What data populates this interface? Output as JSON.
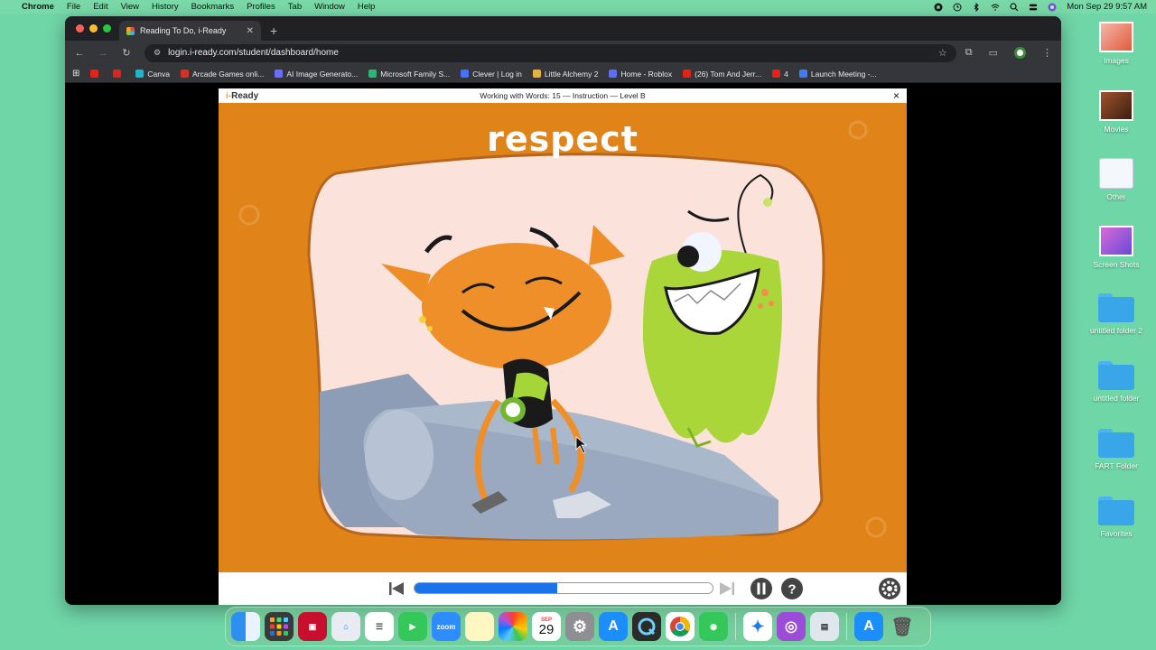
{
  "menubar": {
    "app": "Chrome",
    "items": [
      "File",
      "Edit",
      "View",
      "History",
      "Bookmarks",
      "Profiles",
      "Tab",
      "Window",
      "Help"
    ],
    "clock": "Mon Sep 29  9:57 AM"
  },
  "browser": {
    "tab_title": "Reading To Do, i-Ready",
    "url": "login.i-ready.com/student/dashboard/home",
    "bookmarks": [
      {
        "label": "",
        "color": "#e62117"
      },
      {
        "label": "",
        "color": "#e62117"
      },
      {
        "label": "Canva",
        "color": "#1fb6c9"
      },
      {
        "label": "Arcade Games onli...",
        "color": "#d93025"
      },
      {
        "label": "AI Image Generato...",
        "color": "#6c6cff"
      },
      {
        "label": "Microsoft Family S...",
        "color": "#2bb673"
      },
      {
        "label": "Clever | Log in",
        "color": "#4472ff"
      },
      {
        "label": "Little Alchemy 2",
        "color": "#e8b13a"
      },
      {
        "label": "Home - Roblox",
        "color": "#5b6ef5"
      },
      {
        "label": "(26) Tom And Jerr...",
        "color": "#e62117"
      },
      {
        "label": "4",
        "color": "#e62117"
      },
      {
        "label": "Launch Meeting -...",
        "color": "#3a7bff"
      }
    ]
  },
  "player": {
    "logo_prefix": "i-",
    "logo_text": "Ready",
    "lesson_title": "Working with Words: 15 — Instruction — Level B",
    "word": "respect",
    "progress_percent": 48,
    "icons": {
      "close": "×",
      "rewind": "⏮",
      "forward": "⏭",
      "pause": "⏸",
      "help": "?",
      "settings": "⚙"
    }
  },
  "desktop": {
    "items": [
      {
        "label": "Images"
      },
      {
        "label": "Movies"
      },
      {
        "label": "Other"
      },
      {
        "label": "Screen Shots"
      },
      {
        "label": "untitled folder 2"
      },
      {
        "label": "untitled folder"
      },
      {
        "label": "FART Folder"
      },
      {
        "label": "Favorites"
      }
    ]
  },
  "dock": {
    "calendar_month": "SEP",
    "calendar_day": "29",
    "zoom_label": "zoom"
  }
}
